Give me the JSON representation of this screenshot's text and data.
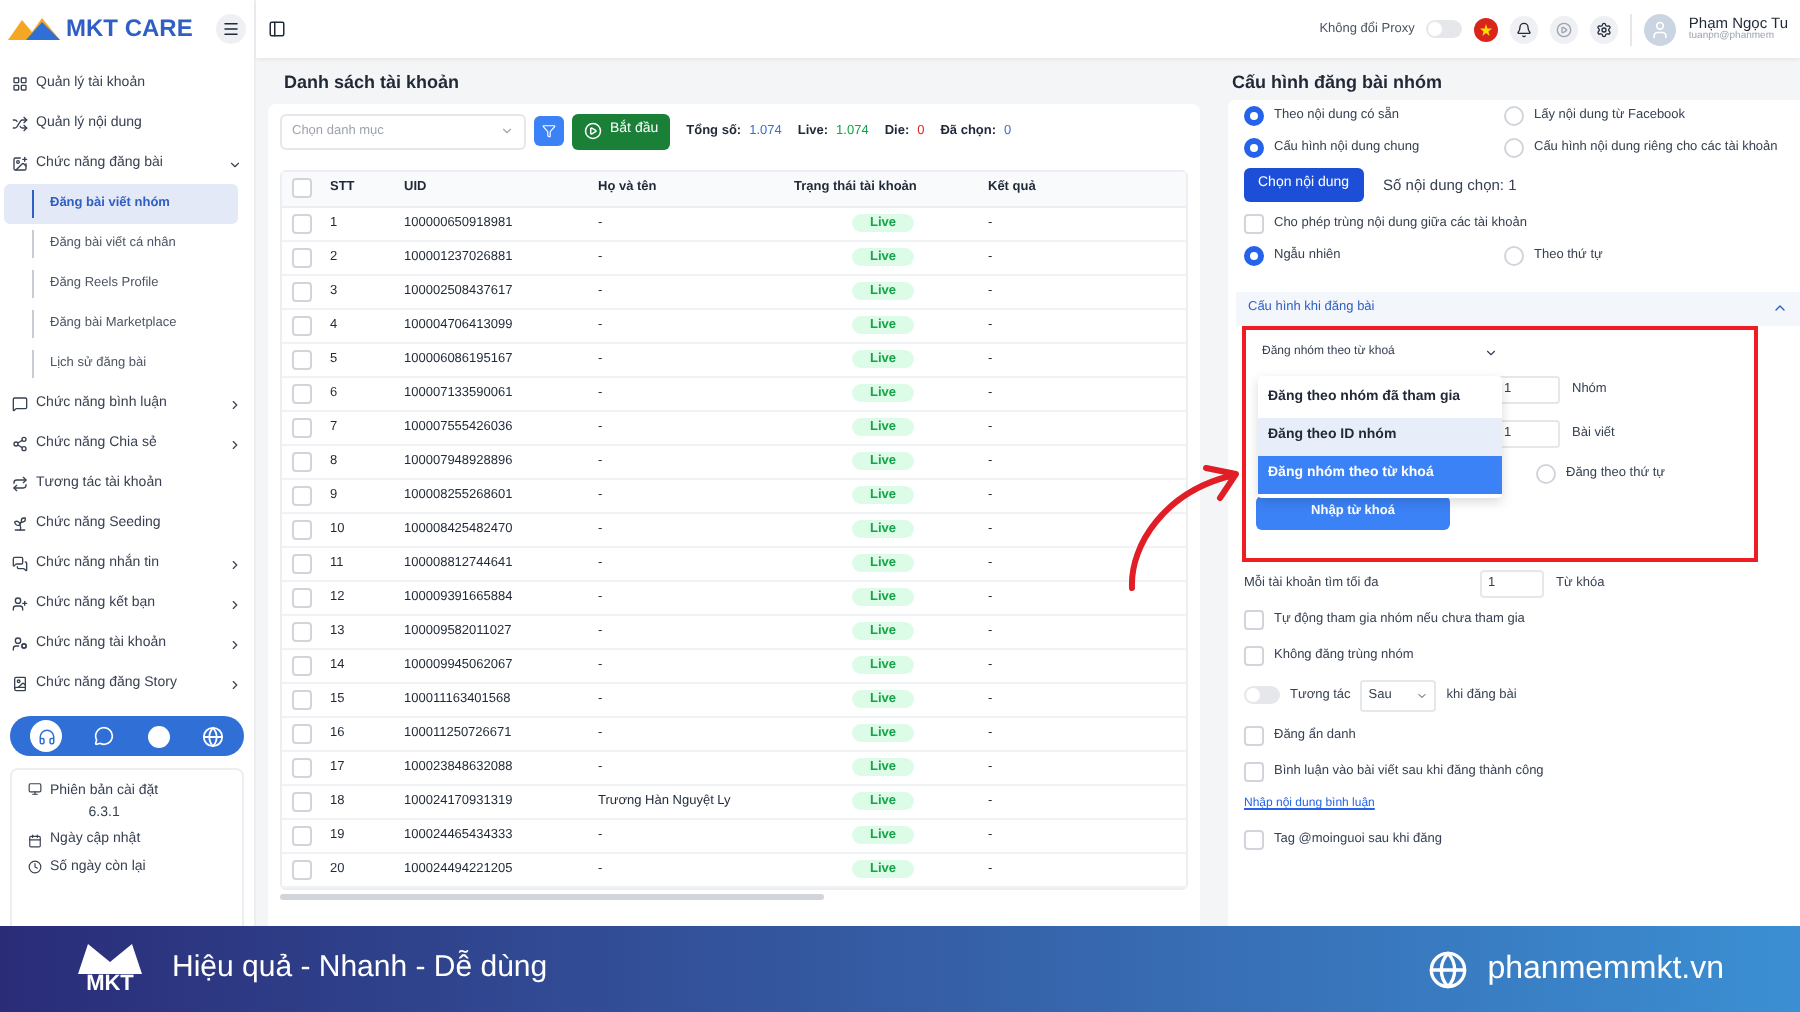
{
  "header": {
    "proxy_label": "Không đổi Proxy",
    "proxy_on": false,
    "user_name": "Phạm Ngọc Tu",
    "user_email": "tuanpn@phanmem"
  },
  "sidebar": {
    "logo_text": "MKT CARE",
    "items": [
      {
        "label": "Quản lý tài khoản",
        "expandable": false
      },
      {
        "label": "Quản lý nội dung",
        "expandable": false
      },
      {
        "label": "Chức năng đăng bài",
        "expandable": true,
        "expanded": true,
        "children": [
          {
            "label": "Đăng bài viết nhóm",
            "selected": true
          },
          {
            "label": "Đăng bài viết cá nhân",
            "selected": false
          },
          {
            "label": "Đăng Reels Profile",
            "selected": false
          },
          {
            "label": "Đăng bài Marketplace",
            "selected": false
          },
          {
            "label": "Lịch sử đăng bài",
            "selected": false
          }
        ]
      },
      {
        "label": "Chức năng bình luận",
        "expandable": true,
        "expanded": false
      },
      {
        "label": "Chức năng Chia sẻ",
        "expandable": true,
        "expanded": false
      },
      {
        "label": "Tương tác tài khoản",
        "expandable": false
      },
      {
        "label": "Chức năng Seeding",
        "expandable": false
      },
      {
        "label": "Chức năng nhắn tin",
        "expandable": true,
        "expanded": false
      },
      {
        "label": "Chức năng kết bạn",
        "expandable": true,
        "expanded": false
      },
      {
        "label": "Chức năng tài khoản",
        "expandable": true,
        "expanded": false
      },
      {
        "label": "Chức năng đăng Story",
        "expandable": true,
        "expanded": false
      }
    ],
    "version_label": "Phiên bản cài đặt",
    "version": "6.3.1",
    "update_label": "Ngày cập nhật",
    "days_label": "Số ngày còn lại"
  },
  "accounts": {
    "title": "Danh sách tài khoản",
    "category_placeholder": "Chọn danh mục",
    "start_button": "Bắt đầu",
    "all_checked": false,
    "stats": [
      {
        "label": "Tổng số:",
        "value": "1.074",
        "color": "#3b6fd8"
      },
      {
        "label": "Live:",
        "value": "1.074",
        "color": "#16a34a"
      },
      {
        "label": "Die:",
        "value": "0",
        "color": "#dc2626"
      },
      {
        "label": "Đã chọn:",
        "value": "0",
        "color": "#3b6fd8"
      }
    ],
    "columns": [
      "STT",
      "UID",
      "Họ và tên",
      "Trạng thái tài khoản",
      "Kết quả"
    ],
    "rows": [
      {
        "stt": "1",
        "uid": "100000650918981",
        "name": "-",
        "status": "Live",
        "result": "-",
        "checked": false
      },
      {
        "stt": "2",
        "uid": "100001237026881",
        "name": "-",
        "status": "Live",
        "result": "-",
        "checked": false
      },
      {
        "stt": "3",
        "uid": "100002508437617",
        "name": "-",
        "status": "Live",
        "result": "-",
        "checked": false
      },
      {
        "stt": "4",
        "uid": "100004706413099",
        "name": "-",
        "status": "Live",
        "result": "-",
        "checked": false
      },
      {
        "stt": "5",
        "uid": "100006086195167",
        "name": "-",
        "status": "Live",
        "result": "-",
        "checked": false
      },
      {
        "stt": "6",
        "uid": "100007133590061",
        "name": "-",
        "status": "Live",
        "result": "-",
        "checked": false
      },
      {
        "stt": "7",
        "uid": "100007555426036",
        "name": "-",
        "status": "Live",
        "result": "-",
        "checked": false
      },
      {
        "stt": "8",
        "uid": "100007948928896",
        "name": "-",
        "status": "Live",
        "result": "-",
        "checked": false
      },
      {
        "stt": "9",
        "uid": "100008255268601",
        "name": "-",
        "status": "Live",
        "result": "-",
        "checked": false
      },
      {
        "stt": "10",
        "uid": "100008425482470",
        "name": "-",
        "status": "Live",
        "result": "-",
        "checked": false
      },
      {
        "stt": "11",
        "uid": "100008812744641",
        "name": "-",
        "status": "Live",
        "result": "-",
        "checked": false
      },
      {
        "stt": "12",
        "uid": "100009391665884",
        "name": "-",
        "status": "Live",
        "result": "-",
        "checked": false
      },
      {
        "stt": "13",
        "uid": "100009582011027",
        "name": "-",
        "status": "Live",
        "result": "-",
        "checked": false
      },
      {
        "stt": "14",
        "uid": "100009945062067",
        "name": "-",
        "status": "Live",
        "result": "-",
        "checked": false
      },
      {
        "stt": "15",
        "uid": "100011163401568",
        "name": "-",
        "status": "Live",
        "result": "-",
        "checked": false
      },
      {
        "stt": "16",
        "uid": "100011250726671",
        "name": "-",
        "status": "Live",
        "result": "-",
        "checked": false
      },
      {
        "stt": "17",
        "uid": "100023848632088",
        "name": "-",
        "status": "Live",
        "result": "-",
        "checked": false
      },
      {
        "stt": "18",
        "uid": "100024170931319",
        "name": "Trương Hàn Nguyệt Ly",
        "status": "Live",
        "result": "-",
        "checked": false
      },
      {
        "stt": "19",
        "uid": "100024465434333",
        "name": "-",
        "status": "Live",
        "result": "-",
        "checked": false
      },
      {
        "stt": "20",
        "uid": "100024494221205",
        "name": "-",
        "status": "Live",
        "result": "-",
        "checked": false
      }
    ]
  },
  "config": {
    "title": "Cấu hình đăng bài nhóm",
    "radio_rows": [
      [
        {
          "label": "Theo nội dung có sẵn",
          "selected": true
        },
        {
          "label": "Lấy nội dung từ Facebook",
          "selected": false
        }
      ],
      [
        {
          "label": "Cấu hình nội dung chung",
          "selected": true
        },
        {
          "label": "Cấu hình nội dung riêng cho các tài khoản",
          "selected": false
        }
      ]
    ],
    "choose_button": "Chọn nội dung",
    "chosen_count": "Số nội dung chọn: 1",
    "allow_duplicate": {
      "label": "Cho phép trùng nội dung giữa các tài khoản",
      "checked": false
    },
    "order": [
      {
        "label": "Ngẫu nhiên",
        "selected": true
      },
      {
        "label": "Theo thứ tự",
        "selected": false
      }
    ],
    "section": {
      "title": "Cấu hình khi đăng bài",
      "expanded": true
    },
    "post_mode": {
      "value": "Đăng nhóm theo từ khoá",
      "options": [
        {
          "label": "Đăng theo nhóm đã tham gia",
          "selected": false,
          "hovered": false
        },
        {
          "label": "Đăng theo ID nhóm",
          "selected": false,
          "hovered": true
        },
        {
          "label": "Đăng nhóm theo từ khoá",
          "selected": true,
          "hovered": false
        }
      ]
    },
    "fields": [
      {
        "value": "1",
        "unit": "Nhóm"
      },
      {
        "value": "1",
        "unit": "Bài viết"
      }
    ],
    "order_radio": {
      "label": "Đăng theo thứ tự",
      "selected": false
    },
    "keyword_button": "Nhập từ khoá",
    "max_keywords": {
      "label": "Mỗi tài khoản tìm tối đa",
      "value": "1",
      "unit": "Từ khóa"
    },
    "checks": [
      {
        "label": "Tự động tham gia nhóm nếu chưa tham gia",
        "checked": false
      },
      {
        "label": "Không đăng trùng nhóm",
        "checked": false
      }
    ],
    "interact": {
      "on": false,
      "label": "Tương tác",
      "select": "Sau",
      "suffix": "khi đăng bài"
    },
    "checks2": [
      {
        "label": "Đăng ẩn danh",
        "checked": false
      },
      {
        "label": "Bình luận vào bài viết sau khi đăng thành công",
        "checked": false
      }
    ],
    "link": "Nhập nội dung bình luận",
    "tag": {
      "label": "Tag @moinguoi sau khi đăng",
      "checked": false
    }
  },
  "banner": {
    "logo_text": "MKT",
    "slogan": "Hiệu quả - Nhanh - Dễ dùng",
    "website": "phanmemmkt.vn"
  }
}
